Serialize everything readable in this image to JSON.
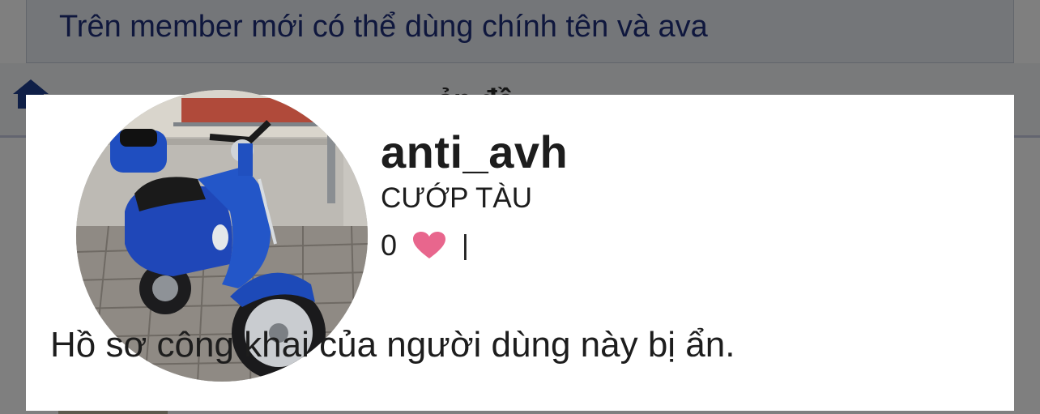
{
  "background": {
    "notice_text": "Trên member mới có thể dùng chính tên và ava",
    "nav_title": "ản đề",
    "home_icon": "home-icon"
  },
  "member_tooltip": {
    "avatar_icon": "vespa-scooter-avatar",
    "username": "anti_avh",
    "user_title": "CƯỚP TÀU",
    "reaction_count": "0",
    "reaction_icon": "heart-icon",
    "reaction_color": "#e8668d",
    "separator": "|",
    "privacy_message": "Hồ sơ công khai của người dùng này bị ẩn."
  }
}
